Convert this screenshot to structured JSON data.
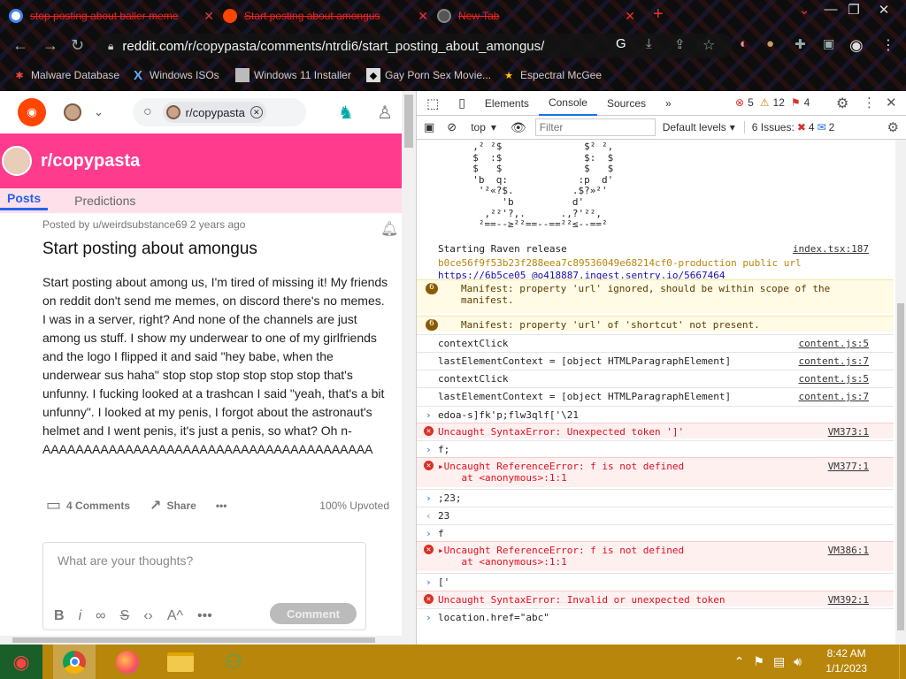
{
  "browser": {
    "tabs": [
      {
        "title": "stop posting about baller meme",
        "close": "✕"
      },
      {
        "title": "Start posting about amongus",
        "close": "✕"
      },
      {
        "title": "New Tab",
        "close": "✕"
      }
    ],
    "new_tab": "+",
    "url_domain": "reddit.com",
    "url_path": "/r/copypasta/comments/ntrdi6/start_posting_about_amongus/",
    "bookmarks": [
      "Malware Database",
      "Windows ISOs",
      "Windows 11 Installer",
      "Gay Porn Sex Movie...",
      "Espectral McGee"
    ]
  },
  "reddit": {
    "search_chip": "r/copypasta",
    "subreddit": "r/copypasta",
    "tabs": [
      "Posts",
      "Predictions"
    ],
    "post": {
      "meta": "Posted by u/weirdsubstance69 2 years ago",
      "title": "Start posting about amongus",
      "body": "Start posting about among us, I'm tired of missing it! My friends on reddit don't send me memes, on discord there's no memes. I was in a server, right? And none of the channels are just among us stuff. I show my underwear to one of my girlfriends and the logo I flipped it and said \"hey babe, when the underwear sus haha\" stop stop stop stop stop stop that's unfunny. I fucking looked at a trashcan I said \"yeah, that's a bit unfunny\". I looked at my penis, I forgot about the astronaut's helmet and I went penis, it's just a penis, so what? Oh n-AAAAAAAAAAAAAAAAAAAAAAAAAAAAAAAAAAAAAAAA",
      "comments": "4 Comments",
      "share": "Share",
      "more": "•••",
      "upvoted": "100% Upvoted"
    },
    "comment_placeholder": "What are your thoughts?",
    "comment_button": "Comment"
  },
  "devtools": {
    "tabs": [
      "Elements",
      "Console",
      "Sources"
    ],
    "counts": {
      "errors": "5",
      "warnings": "12",
      "issues_flag": "4"
    },
    "context": "top",
    "filter_placeholder": "Filter",
    "levels": "Default levels",
    "issues": "6 Issues:",
    "issues_err": "4",
    "issues_info": "2",
    "ascii": [
      "  ,² ²$              $² ²,",
      "  $  :$              $:  $",
      "  $   $              $   $",
      "  'b  q:            :p  d'",
      "   '²«?$.          .$?»²'",
      "       'b          d'",
      "    ,²²'?,.      .,?'²²,",
      "   ²==--≥²²==--==²²≤--==²"
    ],
    "log": [
      {
        "kind": "plain",
        "text": "Starting Raven release",
        "src": "index.tsx:187"
      },
      {
        "kind": "raven",
        "text": "b0ce56f9f53b23f288eea7c89536049e68214cf0-production public url",
        "src": ""
      },
      {
        "kind": "link",
        "text": "https://6b5ce05_@o418887.ingest.sentry.io/5667464",
        "src": ""
      },
      {
        "kind": "warn",
        "badge": "6",
        "text": "Manifest: property 'url' ignored, should be within scope of the",
        "text2": "manifest.",
        "src": ""
      },
      {
        "kind": "warn",
        "badge": "6",
        "text": "Manifest: property 'url' of 'shortcut' not present.",
        "src": ""
      },
      {
        "kind": "plain",
        "text": "contextClick",
        "src": "content.js:5"
      },
      {
        "kind": "plain",
        "text": "lastElementContext = [object HTMLParagraphElement]",
        "src": "content.js:7"
      },
      {
        "kind": "plain",
        "text": "contextClick",
        "src": "content.js:5"
      },
      {
        "kind": "plain",
        "text": "lastElementContext = [object HTMLParagraphElement]",
        "src": "content.js:7"
      },
      {
        "kind": "input",
        "text": "edoa-s]fk'p;flw3qlf['\\21",
        "src": ""
      },
      {
        "kind": "error",
        "text": "Uncaught SyntaxError: Unexpected token ']'",
        "src": "VM373:1"
      },
      {
        "kind": "input",
        "text": "f;",
        "src": ""
      },
      {
        "kind": "error",
        "text": "▸Uncaught ReferenceError: f is not defined",
        "text2": "    at <anonymous>:1:1",
        "src": "VM377:1"
      },
      {
        "kind": "input",
        "text": ";23;",
        "src": ""
      },
      {
        "kind": "result",
        "text": "23",
        "src": ""
      },
      {
        "kind": "input",
        "text": "f",
        "src": ""
      },
      {
        "kind": "error",
        "text": "▸Uncaught ReferenceError: f is not defined",
        "text2": "    at <anonymous>:1:1",
        "src": "VM386:1"
      },
      {
        "kind": "input",
        "text": "['",
        "src": ""
      },
      {
        "kind": "error",
        "text": "Uncaught SyntaxError: Invalid or unexpected token",
        "src": "VM392:1"
      },
      {
        "kind": "prompt",
        "text": "location.href=\"abc\"",
        "src": ""
      }
    ]
  },
  "taskbar": {
    "time": "8:42 AM",
    "date": "1/1/2023"
  }
}
